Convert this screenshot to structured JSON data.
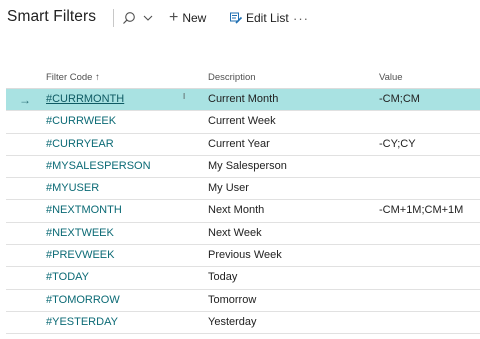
{
  "page": {
    "title": "Smart Filters"
  },
  "toolbar": {
    "new_label": "New",
    "edit_label": "Edit List",
    "more_label": "···"
  },
  "table": {
    "headers": {
      "code": "Filter Code ↑",
      "description": "Description",
      "value": "Value"
    },
    "rows": [
      {
        "code": "#CURRMONTH",
        "description": "Current Month",
        "value": "-CM;CM"
      },
      {
        "code": "#CURRWEEK",
        "description": "Current Week",
        "value": ""
      },
      {
        "code": "#CURRYEAR",
        "description": "Current Year",
        "value": "-CY;CY"
      },
      {
        "code": "#MYSALESPERSON",
        "description": "My Salesperson",
        "value": ""
      },
      {
        "code": "#MYUSER",
        "description": "My User",
        "value": ""
      },
      {
        "code": "#NEXTMONTH",
        "description": "Next Month",
        "value": "-CM+1M;CM+1M"
      },
      {
        "code": "#NEXTWEEK",
        "description": "Next Week",
        "value": ""
      },
      {
        "code": "#PREVWEEK",
        "description": "Previous Week",
        "value": ""
      },
      {
        "code": "#TODAY",
        "description": "Today",
        "value": ""
      },
      {
        "code": "#TOMORROW",
        "description": "Tomorrow",
        "value": ""
      },
      {
        "code": "#YESTERDAY",
        "description": "Yesterday",
        "value": ""
      }
    ],
    "selected_arrow": "→"
  },
  "colors": {
    "selected_row": "#a9e2e2",
    "link": "#0b6a75"
  }
}
